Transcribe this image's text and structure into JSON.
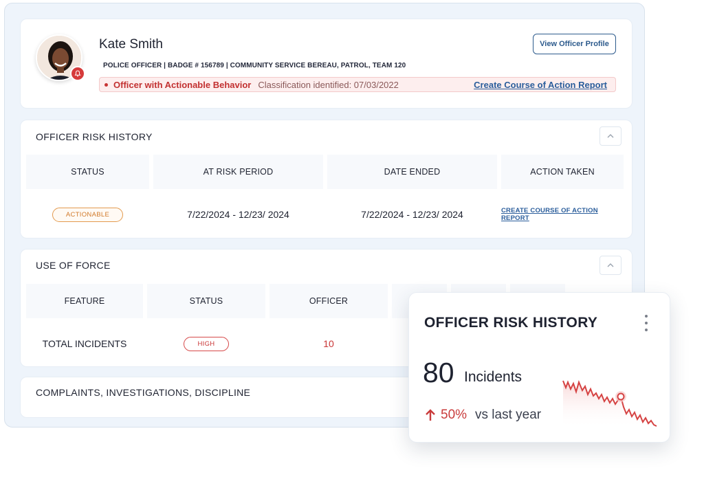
{
  "profile": {
    "name": "Kate Smith",
    "meta": "POLICE OFFICER | BADGE # 156789 | COMMUNITY SERVICE BEREAU, PATROL, TEAM 120",
    "view_profile_label": "View Officer Profile",
    "alert_flag": "Officer with Actionable Behavior",
    "alert_classification": "Classification identified: 07/03/2022",
    "alert_link": "Create Course of Action Report"
  },
  "risk_history": {
    "title": "OFFICER RISK HISTORY",
    "columns": [
      "STATUS",
      "AT RISK PERIOD",
      "DATE ENDED",
      "ACTION TAKEN"
    ],
    "rows": [
      {
        "status": "ACTIONABLE",
        "period": "7/22/2024 - 12/23/ 2024",
        "ended": "7/22/2024 - 12/23/ 2024",
        "action": "CREATE COURSE OF ACTION REPORT"
      }
    ]
  },
  "use_of_force": {
    "title": "USE OF FORCE",
    "columns": [
      "FEATURE",
      "STATUS",
      "OFFICER"
    ],
    "rows": [
      {
        "feature": "TOTAL INCIDENTS",
        "status": "HIGH",
        "officer": "10"
      }
    ]
  },
  "complaints": {
    "title": "COMPLAINTS, INVESTIGATIONS, DISCIPLINE"
  },
  "widget": {
    "title": "OFFICER RISK HISTORY",
    "value": "80",
    "unit": "Incidents",
    "change_pct": "50%",
    "change_label": "vs last year",
    "accent": "#c93b3b"
  },
  "colors": {
    "primary": "#2c5a8c",
    "alert": "#c23030",
    "actionable": "#d17a2a",
    "high": "#c93535"
  },
  "icons": {
    "avatar_badge": "bell-icon",
    "collapse": "chevron-up-icon",
    "change": "arrow-up-icon",
    "menu": "kebab-menu-icon"
  }
}
